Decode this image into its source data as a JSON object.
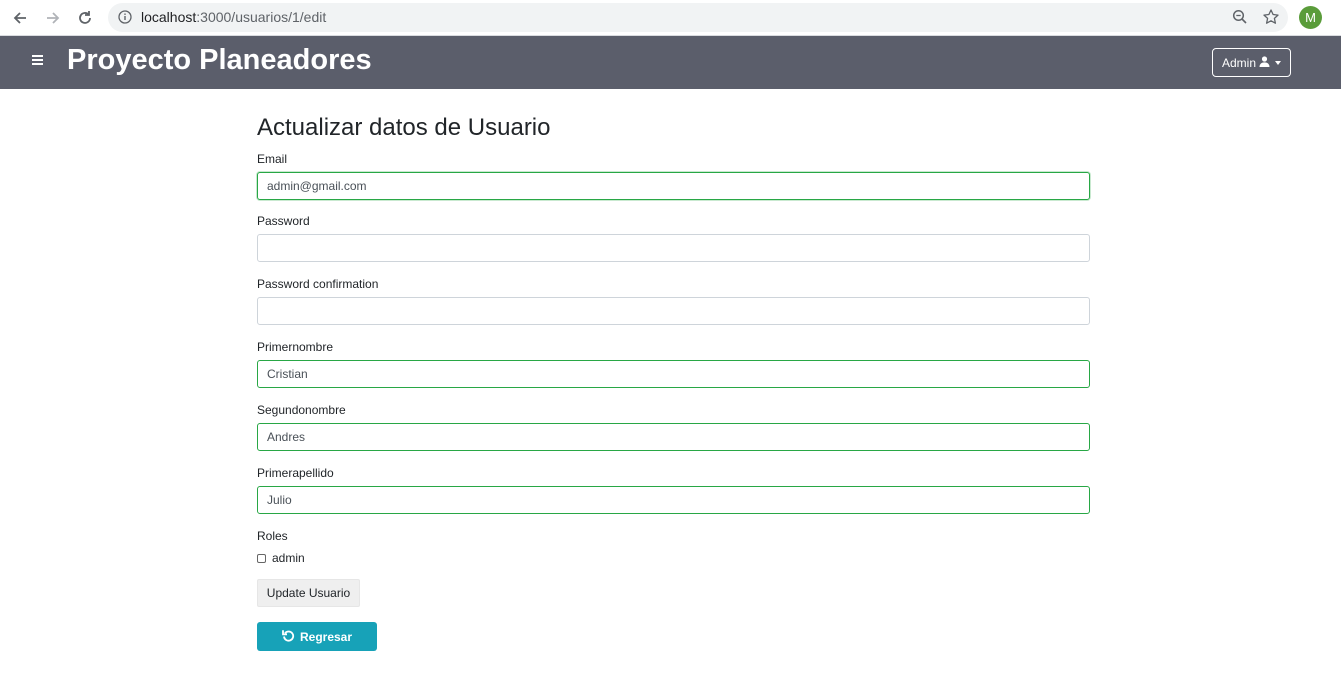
{
  "browser": {
    "url_host": "localhost",
    "url_path": ":3000/usuarios/1/edit",
    "profile_initial": "M"
  },
  "navbar": {
    "brand": "Proyecto Planeadores",
    "user_menu_label": "Admin"
  },
  "form": {
    "title": "Actualizar datos de Usuario",
    "email": {
      "label": "Email",
      "value": "admin@gmail.com"
    },
    "password": {
      "label": "Password",
      "value": ""
    },
    "password_confirmation": {
      "label": "Password confirmation",
      "value": ""
    },
    "primernombre": {
      "label": "Primernombre",
      "value": "Cristian"
    },
    "segundonombre": {
      "label": "Segundonombre",
      "value": "Andres"
    },
    "primerapellido": {
      "label": "Primerapellido",
      "value": "Julio"
    },
    "roles": {
      "label": "Roles",
      "options": [
        "admin"
      ],
      "checked": [
        false
      ]
    },
    "submit_label": "Update Usuario",
    "back_label": "Regresar"
  },
  "colors": {
    "navbar_bg": "#5b5e6b",
    "valid_border": "#28a745",
    "back_button_bg": "#17a2b8"
  }
}
